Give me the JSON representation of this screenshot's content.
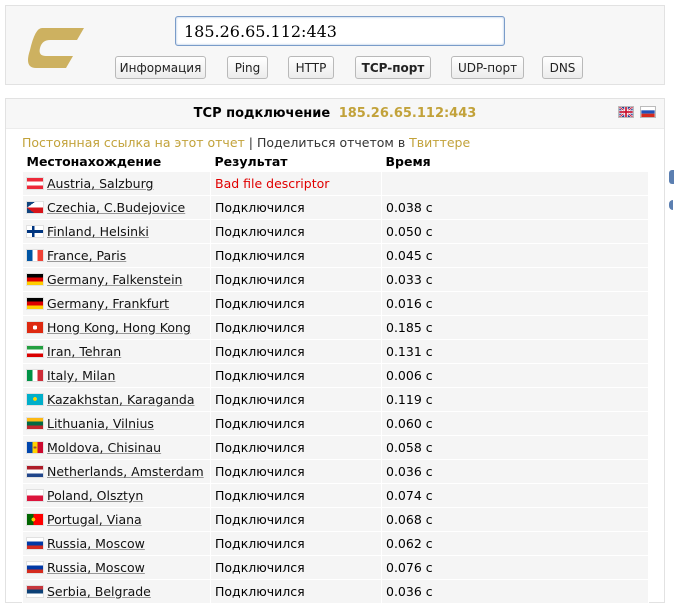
{
  "search": {
    "value": "185.26.65.112:443"
  },
  "tabs": [
    {
      "label": "Информация",
      "active": false
    },
    {
      "label": "Ping",
      "active": false
    },
    {
      "label": "HTTP",
      "active": false
    },
    {
      "label": "TCP-порт",
      "active": true
    },
    {
      "label": "UDP-порт",
      "active": false
    },
    {
      "label": "DNS",
      "active": false
    }
  ],
  "panel": {
    "title": "TCP подключение",
    "host": "185.26.65.112:443"
  },
  "share": {
    "permalink": "Постоянная ссылка на этот отчет",
    "separator": " | ",
    "share_text": "Поделиться отчетом",
    "in_word": " в ",
    "twitter": "Твиттере"
  },
  "table": {
    "headers": [
      "Местонахождение",
      "Результат",
      "Время"
    ],
    "rows": [
      {
        "flag": "at",
        "location": "Austria, Salzburg",
        "result": "Bad file descriptor",
        "time": "",
        "error": true
      },
      {
        "flag": "cz",
        "location": "Czechia, C.Budejovice",
        "result": "Подключился",
        "time": "0.038 с"
      },
      {
        "flag": "fi",
        "location": "Finland, Helsinki",
        "result": "Подключился",
        "time": "0.050 с"
      },
      {
        "flag": "fr",
        "location": "France, Paris",
        "result": "Подключился",
        "time": "0.045 с"
      },
      {
        "flag": "de",
        "location": "Germany, Falkenstein",
        "result": "Подключился",
        "time": "0.033 с"
      },
      {
        "flag": "de",
        "location": "Germany, Frankfurt",
        "result": "Подключился",
        "time": "0.016 с"
      },
      {
        "flag": "hk",
        "location": "Hong Kong, Hong Kong",
        "result": "Подключился",
        "time": "0.185 с"
      },
      {
        "flag": "ir",
        "location": "Iran, Tehran",
        "result": "Подключился",
        "time": "0.131 с"
      },
      {
        "flag": "it",
        "location": "Italy, Milan",
        "result": "Подключился",
        "time": "0.006 с"
      },
      {
        "flag": "kz",
        "location": "Kazakhstan, Karaganda",
        "result": "Подключился",
        "time": "0.119 с"
      },
      {
        "flag": "lt",
        "location": "Lithuania, Vilnius",
        "result": "Подключился",
        "time": "0.060 с"
      },
      {
        "flag": "md",
        "location": "Moldova, Chisinau",
        "result": "Подключился",
        "time": "0.058 с"
      },
      {
        "flag": "nl",
        "location": "Netherlands, Amsterdam",
        "result": "Подключился",
        "time": "0.036 с"
      },
      {
        "flag": "pl",
        "location": "Poland, Olsztyn",
        "result": "Подключился",
        "time": "0.074 с"
      },
      {
        "flag": "pt",
        "location": "Portugal, Viana",
        "result": "Подключился",
        "time": "0.068 с"
      },
      {
        "flag": "ru",
        "location": "Russia, Moscow",
        "result": "Подключился",
        "time": "0.062 с"
      },
      {
        "flag": "ru",
        "location": "Russia, Moscow",
        "result": "Подключился",
        "time": "0.076 с"
      },
      {
        "flag": "rs",
        "location": "Serbia, Belgrade",
        "result": "Подключился",
        "time": "0.036 с"
      }
    ]
  },
  "colors": {
    "accent": "#c2a23a",
    "error": "#e00000",
    "row_bg": "#f5f5f5"
  },
  "language_flags": [
    "uk-flag-icon",
    "ru-flag-icon"
  ]
}
